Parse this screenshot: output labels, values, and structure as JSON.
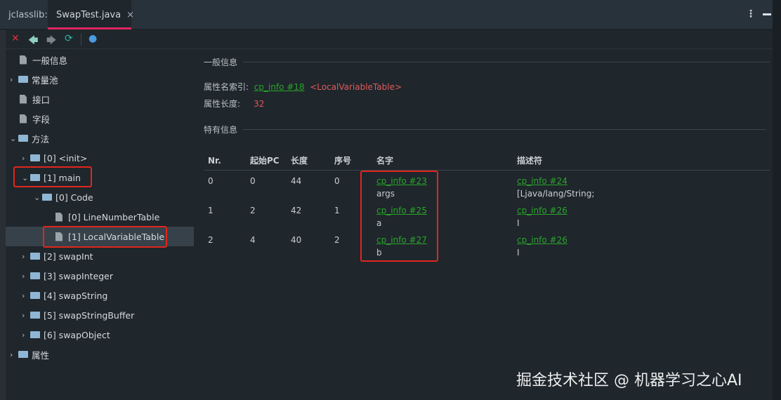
{
  "app_label": "jclasslib:",
  "tab": {
    "label": "SwapTest.java",
    "close": "×"
  },
  "window": {
    "more": "⋮"
  },
  "toolbar": {
    "close": "✕",
    "back": "🡄",
    "forward": "🡆",
    "refresh": "⟳",
    "browser": "●"
  },
  "tree": [
    {
      "label": "一般信息",
      "type": "file",
      "level": 0
    },
    {
      "label": "常量池",
      "type": "folder",
      "level": 0,
      "exp": "›"
    },
    {
      "label": "接口",
      "type": "file",
      "level": 0
    },
    {
      "label": "字段",
      "type": "file",
      "level": 0
    },
    {
      "label": "方法",
      "type": "folder",
      "level": 0,
      "exp": "⌄"
    },
    {
      "label": "[0] <init>",
      "type": "folder",
      "level": 1,
      "exp": "›"
    },
    {
      "label": "[1] main",
      "type": "folder",
      "level": 1,
      "exp": "⌄"
    },
    {
      "label": "[0] Code",
      "type": "folder",
      "level": 2,
      "exp": "⌄"
    },
    {
      "label": "[0] LineNumberTable",
      "type": "file",
      "level": 3
    },
    {
      "label": "[1] LocalVariableTable",
      "type": "file",
      "level": 3
    },
    {
      "label": "[2] swapInt",
      "type": "folder",
      "level": 1,
      "exp": "›"
    },
    {
      "label": "[3] swapInteger",
      "type": "folder",
      "level": 1,
      "exp": "›"
    },
    {
      "label": "[4] swapString",
      "type": "folder",
      "level": 1,
      "exp": "›"
    },
    {
      "label": "[5] swapStringBuffer",
      "type": "folder",
      "level": 1,
      "exp": "›"
    },
    {
      "label": "[6] swapObject",
      "type": "folder",
      "level": 1,
      "exp": "›"
    },
    {
      "label": "属性",
      "type": "folder",
      "level": 0,
      "exp": "›"
    }
  ],
  "general": {
    "title": "一般信息",
    "name_index_label": "属性名索引:",
    "name_index_link": "cp_info #18",
    "name_index_value": "<LocalVariableTable>",
    "length_label": "属性长度:",
    "length_value": "32"
  },
  "specific": {
    "title": "特有信息"
  },
  "table": {
    "headers": [
      "Nr.",
      "起始PC",
      "长度",
      "序号",
      "名字",
      "描述符"
    ],
    "rows": [
      {
        "nr": "0",
        "start_pc": "0",
        "length": "44",
        "index": "0",
        "name_link": "cp_info #23",
        "name": "args",
        "desc_link": "cp_info #24",
        "desc": "[Ljava/lang/String;"
      },
      {
        "nr": "1",
        "start_pc": "2",
        "length": "42",
        "index": "1",
        "name_link": "cp_info #25",
        "name": "a",
        "desc_link": "cp_info #26",
        "desc": "I"
      },
      {
        "nr": "2",
        "start_pc": "4",
        "length": "40",
        "index": "2",
        "name_link": "cp_info #27",
        "name": "b",
        "desc_link": "cp_info #26",
        "desc": "I"
      }
    ]
  },
  "watermark": "掘金技术社区 @ 机器学习之心AI"
}
